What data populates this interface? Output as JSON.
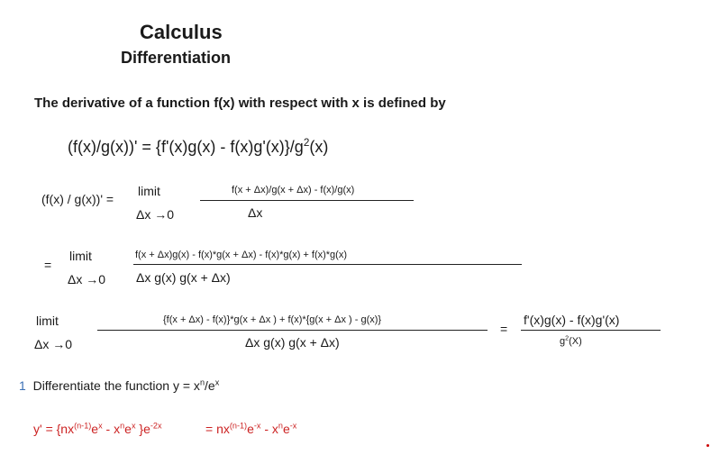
{
  "header": {
    "title": "Calculus",
    "subtitle": "Differentiation"
  },
  "intro": "The derivative of a function f(x) with respect with x is defined by",
  "main_formula": {
    "lhs": "(f(x)/g(x))' = {f'(x)g(x) - f(x)g'(x)}/g",
    "sup": "2",
    "rhs": "(x)"
  },
  "step1": {
    "lhs": "(f(x) / g(x))' =",
    "limit": "limit",
    "limit_sub": "Δx →0",
    "numerator": "f(x + Δx)/g(x + Δx)  - f(x)/g(x)",
    "denominator": "Δx"
  },
  "step2": {
    "eq": "=",
    "limit": "limit",
    "limit_sub": "Δx →0",
    "numerator": "f(x + Δx)g(x)  - f(x)*g(x + Δx) - f(x)*g(x) + f(x)*g(x)",
    "denominator": "Δx g(x) g(x + Δx)"
  },
  "step3": {
    "limit": "limit",
    "limit_sub": "Δx →0",
    "numerator": "{f(x + Δx) - f(x)}*g(x + Δx ) + f(x)*{g(x + Δx ) - g(x)}",
    "denominator": "Δx g(x) g(x + Δx)",
    "eq": "=",
    "result_numerator": "f'(x)g(x) - f(x)g'(x)",
    "result_denominator_base": "g",
    "result_denominator_sup": "2",
    "result_denominator_tail": "(X)"
  },
  "exercise": {
    "number": "1",
    "text": "Differentiate the function y = x",
    "sup_n": "n",
    "slash_e": "/e",
    "sup_x": "x"
  },
  "answer": {
    "part1_a": "y' = {nx",
    "part1_sup1": "(n-1)",
    "part1_b": "e",
    "part1_sup2": "x",
    "part1_c": " - x",
    "part1_sup3": "n",
    "part1_d": "e",
    "part1_sup4": "x",
    "part1_e": " }e",
    "part1_sup5": "-2x",
    "part2_a": "= nx",
    "part2_sup1": "(n-1)",
    "part2_b": "e",
    "part2_sup2": "-x",
    "part2_c": " - x",
    "part2_sup3": "n",
    "part2_d": "e",
    "part2_sup4": "-x"
  },
  "colors": {
    "text": "#1a1a1a",
    "answer": "#cc2222",
    "number": "#3a6fb5"
  }
}
